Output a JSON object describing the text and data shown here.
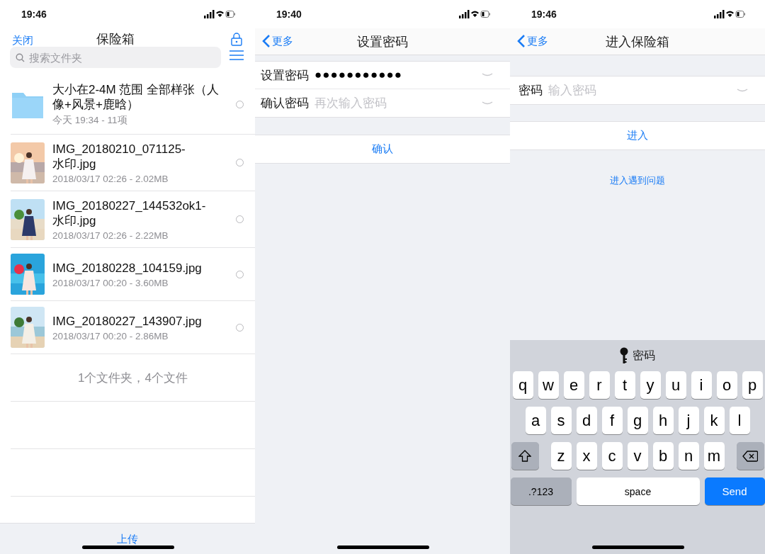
{
  "vault_screen": {
    "status_bar": {
      "time": "19:46"
    },
    "close": "关闭",
    "title": "保险箱",
    "search": {
      "placeholder": "搜索文件夹"
    },
    "items": [
      {
        "kind": "folder",
        "name": "大小在2-4M 范围 全部样张（人像+风景+鹿晗）",
        "meta": "今天 19:34 - 11项",
        "selected": false
      },
      {
        "name": "IMG_20180210_071125-水印.jpg",
        "meta": "2018/03/17 02:26 - 2.02MB",
        "selected": false
      },
      {
        "name": "IMG_20180227_144532ok1-水印.jpg",
        "meta": "2018/03/17 02:26 - 2.22MB",
        "selected": false
      },
      {
        "name": "IMG_20180228_104159.jpg",
        "meta": "2018/03/17 00:20 - 3.60MB",
        "selected": false
      },
      {
        "name": "IMG_20180227_143907.jpg",
        "meta": "2018/03/17 00:20 - 2.86MB",
        "selected": false
      }
    ],
    "summary": "1个文件夹，4个文件",
    "upload": "上传"
  },
  "set_password_screen": {
    "status_bar": {
      "time": "19:40"
    },
    "back": "更多",
    "title": "设置密码",
    "fields": [
      {
        "label": "设置密码",
        "value": "●●●●●●●●●●●"
      },
      {
        "label": "确认密码",
        "placeholder": "再次输入密码"
      }
    ],
    "confirm": "确认"
  },
  "enter_vault_screen": {
    "status_bar": {
      "time": "19:46"
    },
    "back": "更多",
    "title": "进入保险箱",
    "field": {
      "label": "密码",
      "placeholder": "输入密码"
    },
    "enter": "进入",
    "help_link": "进入遇到问题",
    "keyboard": {
      "suggestion": "密码",
      "rows": [
        [
          "q",
          "w",
          "e",
          "r",
          "t",
          "y",
          "u",
          "i",
          "o",
          "p"
        ],
        [
          "a",
          "s",
          "d",
          "f",
          "g",
          "h",
          "j",
          "k",
          "l"
        ],
        [
          "z",
          "x",
          "c",
          "v",
          "b",
          "n",
          "m"
        ]
      ],
      "numbers_key": ".?123",
      "space_key": "space",
      "send_key": "Send"
    }
  }
}
